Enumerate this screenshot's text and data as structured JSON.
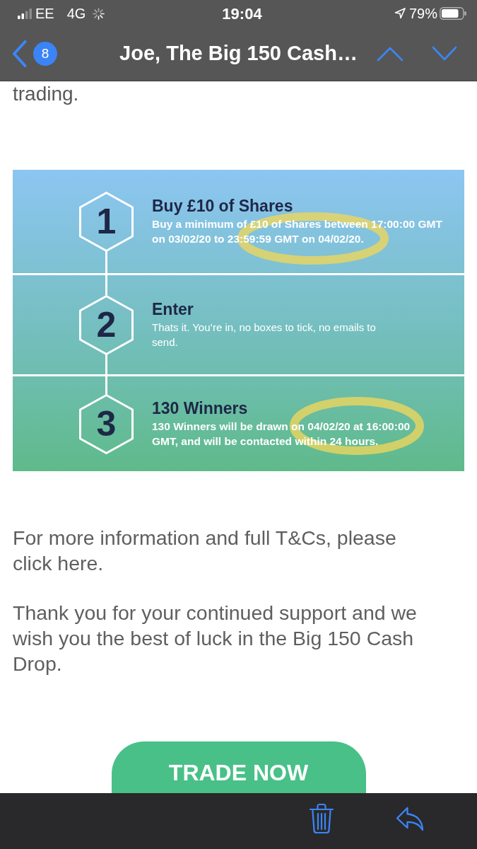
{
  "status_bar": {
    "carrier": "EE",
    "network": "4G",
    "time": "19:04",
    "battery": "79%"
  },
  "nav_bar": {
    "unread_count": "8",
    "title": "Joe, The Big 150 Cash…"
  },
  "email": {
    "leading_text": "trading.",
    "steps": [
      {
        "number": "1",
        "title": "Buy £10 of Shares",
        "description": "Buy a minimum of £10 of Shares between 17:00:00 GMT on 03/02/20 to 23:59:59 GMT on 04/02/20.",
        "circled": true
      },
      {
        "number": "2",
        "title": "Enter",
        "description": "Thats it. You’re in, no boxes to tick, no emails to send.",
        "circled": false
      },
      {
        "number": "3",
        "title": "130 Winners",
        "description": "130 Winners will be drawn on 04/02/20 at 16:00:00 GMT, and will be contacted within 24 hours.",
        "circled": true
      }
    ],
    "paragraphs": [
      "For more information and full T&Cs, please click here.",
      "Thank you for your continued support and we wish you the best of luck in the Big 150 Cash Drop."
    ],
    "button": "TRADE NOW"
  }
}
